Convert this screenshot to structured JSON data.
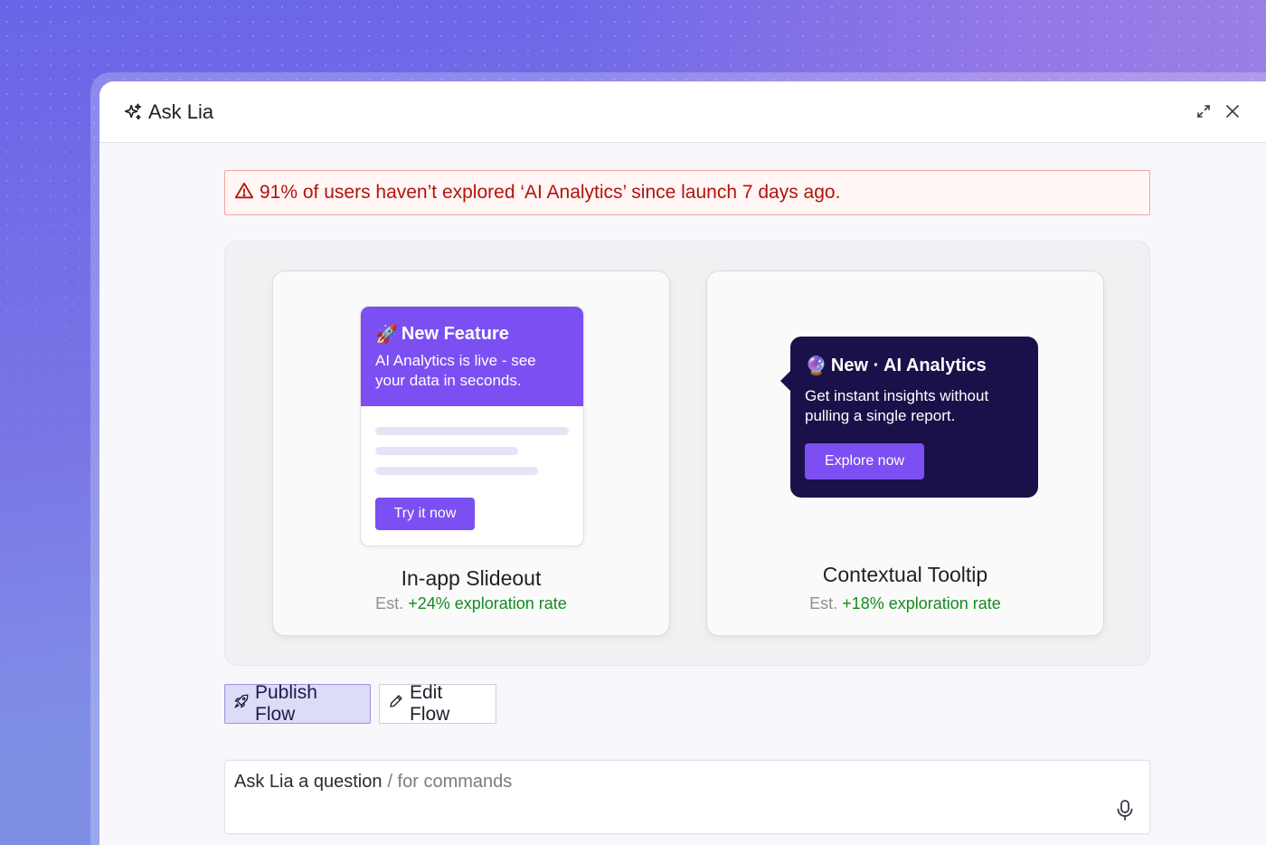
{
  "header": {
    "title": "Ask Lia"
  },
  "alert": {
    "text": "91% of users haven’t explored ‘AI Analytics’ since launch 7 days ago."
  },
  "cards": [
    {
      "preview": {
        "title": "New Feature",
        "emoji": "🚀",
        "body": "AI Analytics is live - see your data in seconds.",
        "button": "Try it now"
      },
      "label": "In-app Slideout",
      "est": "Est.",
      "rate": "+24% exploration rate"
    },
    {
      "preview": {
        "title": "New · AI Analytics",
        "emoji": "🔮",
        "body": "Get instant insights without pulling a single report.",
        "button": "Explore now"
      },
      "label": "Contextual Tooltip",
      "est": "Est.",
      "rate": "+18% exploration rate"
    }
  ],
  "actions": {
    "publish": "Publish Flow",
    "edit": "Edit Flow"
  },
  "ask": {
    "placeholder": "Ask Lia a question",
    "hint": "/ for commands"
  },
  "colors": {
    "accent_purple": "#7b4ff2",
    "tooltip_bg": "#1b114a",
    "alert_red": "#b3130b",
    "success_green": "#128c1b"
  },
  "icons": [
    "sparkle-icon",
    "expand-icon",
    "close-icon",
    "warning-icon",
    "rocket-icon",
    "pencil-icon",
    "microphone-icon"
  ]
}
